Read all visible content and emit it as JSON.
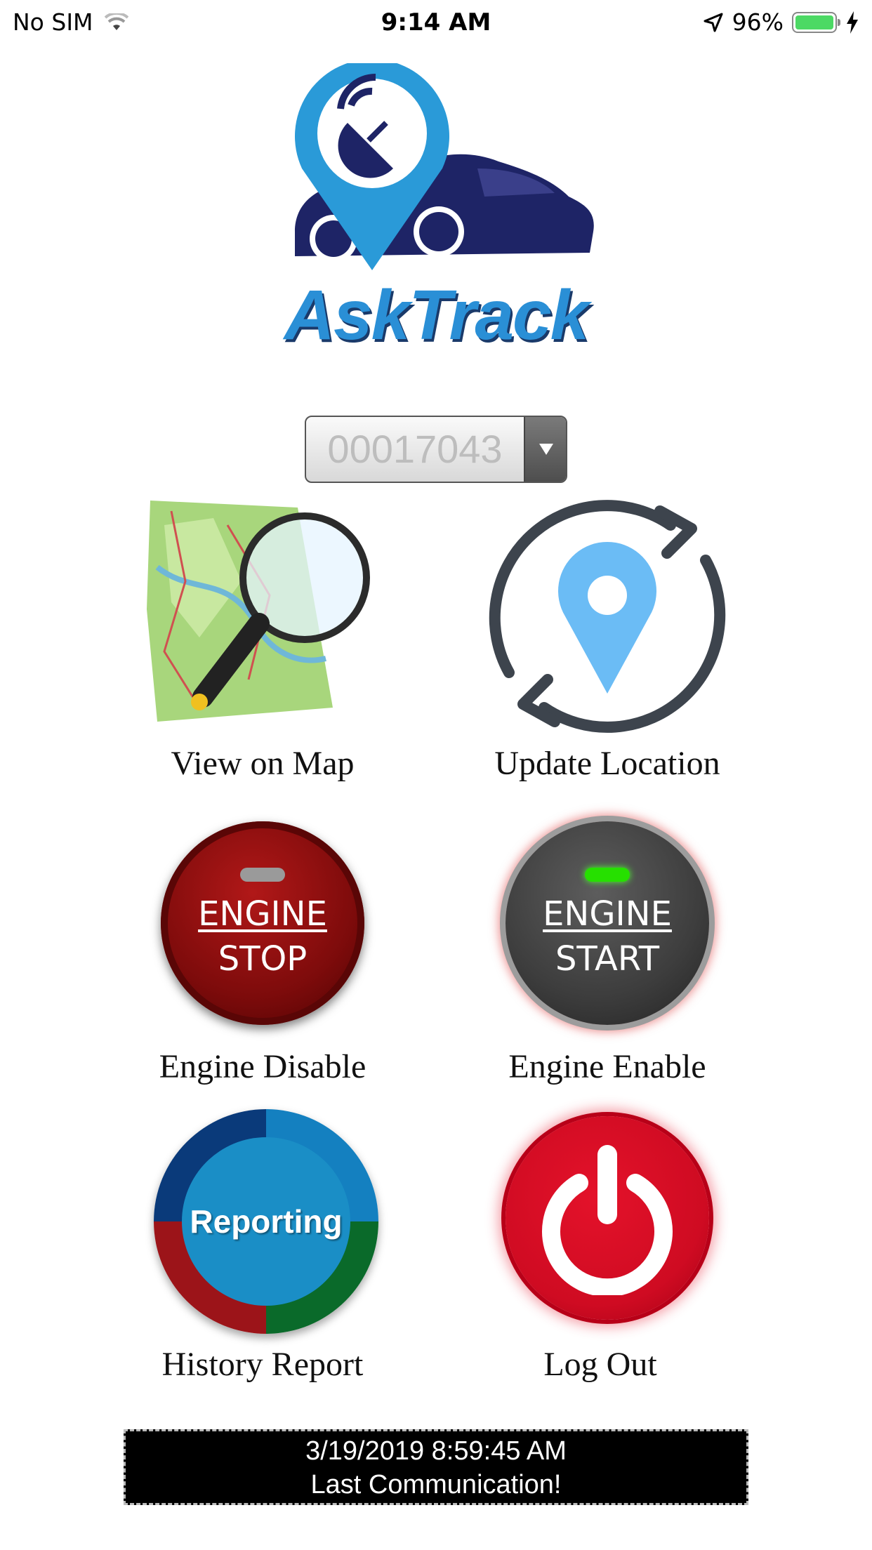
{
  "status_bar": {
    "carrier": "No SIM",
    "time": "9:14 AM",
    "battery_percent": "96%",
    "icons": [
      "wifi-icon",
      "location-arrow-icon",
      "battery-icon",
      "charging-bolt-icon"
    ]
  },
  "logo": {
    "text": "AskTrack",
    "colors": {
      "pin": "#2a9ad8",
      "car": "#1e2466",
      "text": "#2a8fd6"
    }
  },
  "device_select": {
    "selected_value": "00017043"
  },
  "tiles": [
    {
      "label": "View on Map",
      "icon": "map-magnifier-icon"
    },
    {
      "label": "Update Location",
      "icon": "refresh-location-icon"
    },
    {
      "label": "Engine Disable",
      "icon": "engine-stop-button",
      "button_line1": "ENGINE",
      "button_line2": "STOP"
    },
    {
      "label": "Engine Enable",
      "icon": "engine-start-button",
      "button_line1": "ENGINE",
      "button_line2": "START"
    },
    {
      "label": "History Report",
      "icon": "reporting-button",
      "button_text": "Reporting"
    },
    {
      "label": "Log Out",
      "icon": "power-icon"
    }
  ],
  "last_communication": {
    "timestamp": "3/19/2019 8:59:45 AM",
    "message": "Last Communication!"
  }
}
